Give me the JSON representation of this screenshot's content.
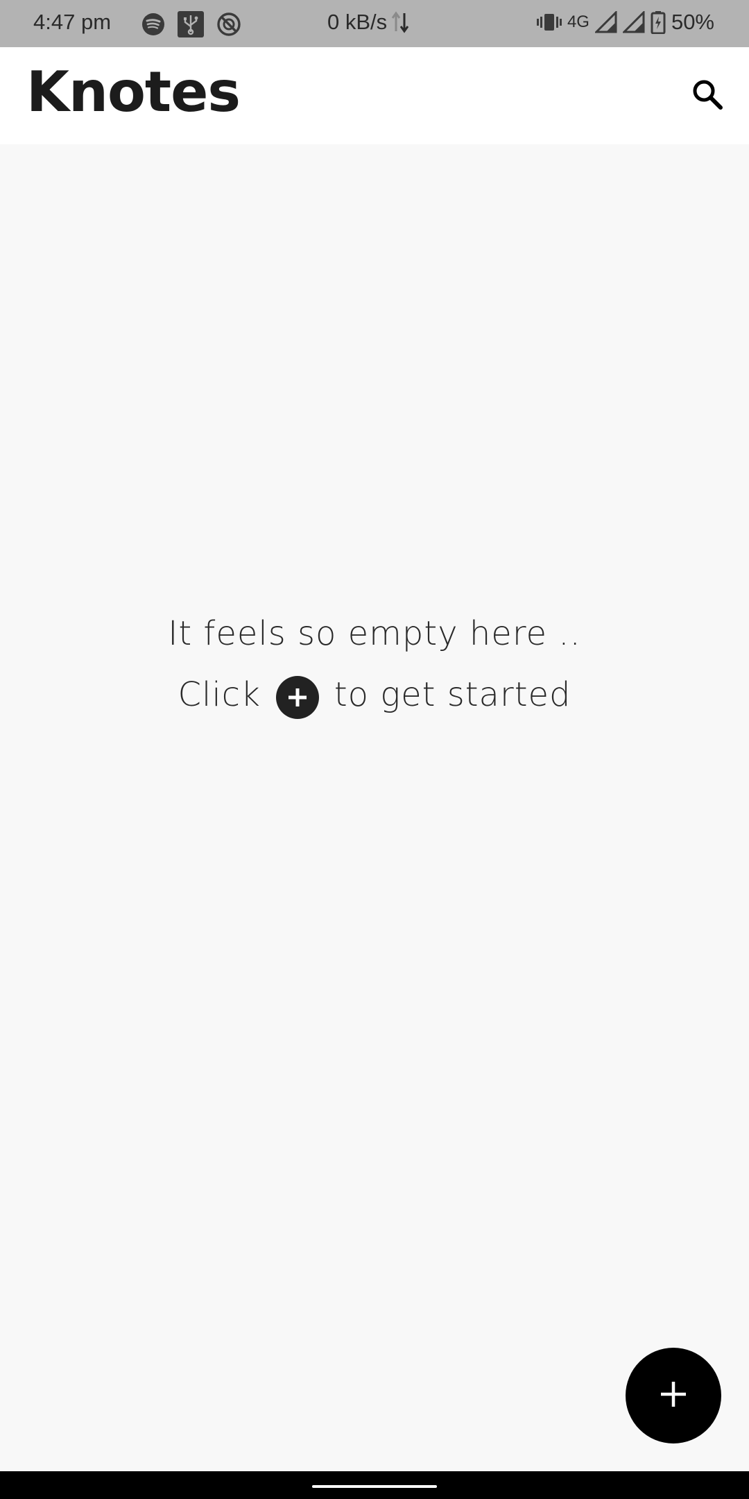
{
  "status_bar": {
    "time": "4:47 pm",
    "speed": "0 kB/s",
    "network": "4G",
    "battery": "50%",
    "icons": [
      "spotify-icon",
      "usb-icon",
      "vpn-icon",
      "data-arrows-icon",
      "vibrate-icon",
      "signal-icon",
      "signal-icon",
      "battery-charging-icon"
    ]
  },
  "app_bar": {
    "title": "Knotes",
    "search_icon": "search-icon"
  },
  "empty_state": {
    "line1": "It feels so empty here ..",
    "line2_before": "Click",
    "line2_after": "to get started",
    "inline_icon": "add-circle-icon"
  },
  "fab": {
    "icon": "plus-icon"
  },
  "colors": {
    "status_bar_bg": "#b3b3b3",
    "app_bar_bg": "#ffffff",
    "content_bg": "#f8f8f8",
    "fab_bg": "#000000",
    "text": "#2a2a2a"
  }
}
